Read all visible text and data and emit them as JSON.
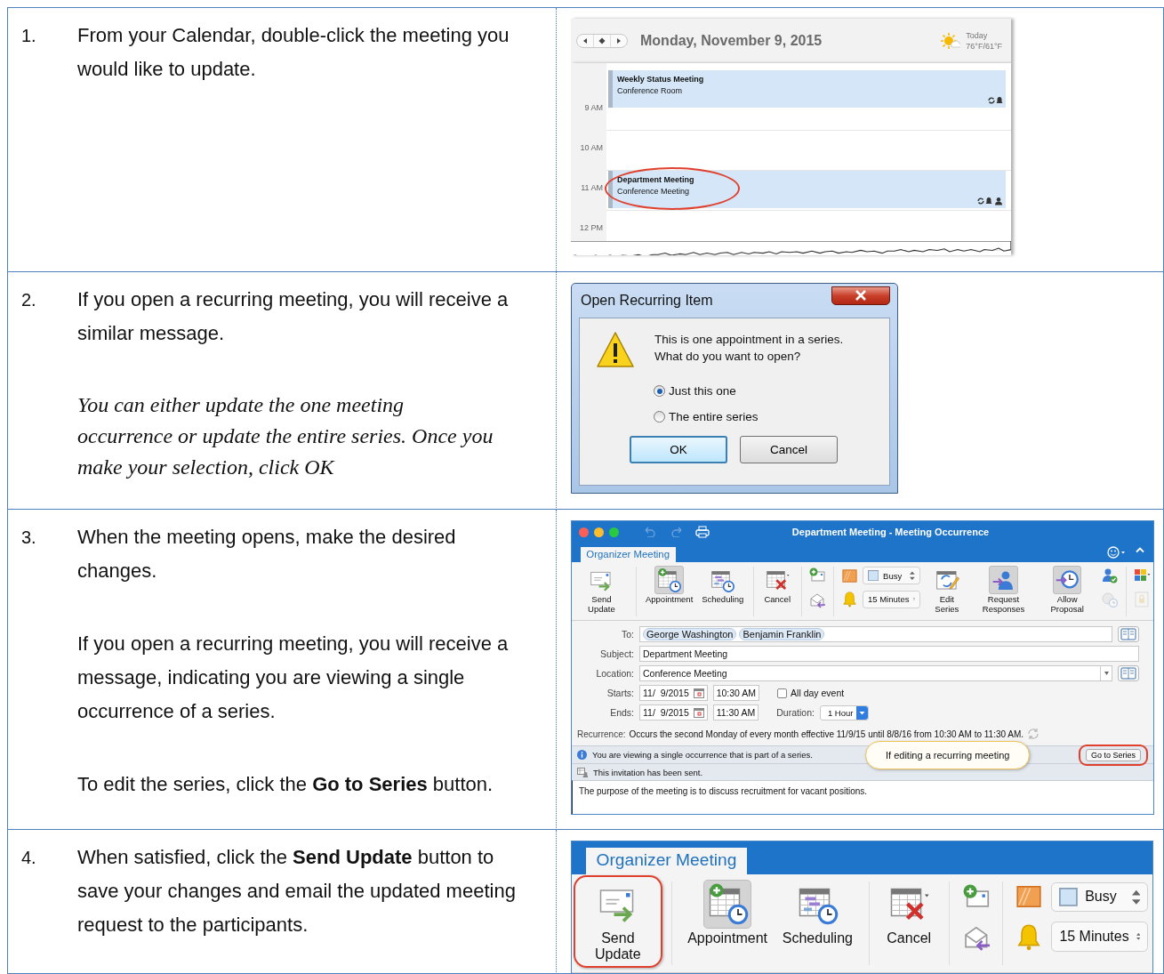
{
  "steps": [
    {
      "number": "1.",
      "paragraphs": [
        {
          "kind": "normal",
          "text": "From your Calendar, double-click the meeting you would like to update."
        }
      ],
      "screenshot": {
        "kind": "calendar",
        "date": "Monday, November 9, 2015",
        "weather": {
          "label": "Today",
          "temperature": "76°F/61°F"
        },
        "hours": [
          "9 AM",
          "10 AM",
          "11 AM",
          "12 PM"
        ],
        "events": [
          {
            "title": "Weekly Status Meeting",
            "location": "Conference Room",
            "attendees": false,
            "circled": false
          },
          {
            "title": "Department Meeting",
            "location": "Conference Meeting",
            "attendees": true,
            "circled": true
          }
        ]
      }
    },
    {
      "number": "2.",
      "paragraphs": [
        {
          "kind": "normal",
          "text": "If you open a recurring meeting, you will receive a similar message."
        },
        {
          "kind": "italic",
          "text": "You can either update the one meeting occurrence or update the entire series.  Once you make your selection, click OK"
        }
      ],
      "screenshot": {
        "kind": "dialog",
        "title": "Open Recurring Item",
        "message": [
          "This is one appointment in a series.",
          "What do you want to open?"
        ],
        "options": [
          {
            "label": "Just this one",
            "selected": true
          },
          {
            "label": "The entire series",
            "selected": false
          }
        ],
        "buttons": [
          {
            "label": "OK",
            "default": true
          },
          {
            "label": "Cancel",
            "default": false
          }
        ]
      }
    },
    {
      "number": "3.",
      "paragraphs": [
        {
          "kind": "normal",
          "text": "When the meeting opens, make the desired changes."
        },
        {
          "kind": "normal",
          "text": "If you open a recurring meeting, you will receive a message, indicating you are viewing a single occurrence of a series."
        },
        {
          "kind": "normal",
          "text": "To edit the series, click the **Go to Series** button."
        }
      ],
      "screenshot": {
        "kind": "meeting_window",
        "title": "Department Meeting - Meeting Occurrence",
        "ribbon": {
          "tab": "Organizer Meeting",
          "groups": [
            {
              "items": [
                {
                  "kind": "send",
                  "label": "Send Update",
                  "selected": false
                }
              ]
            },
            {
              "items": [
                {
                  "kind": "appointment",
                  "label": "Appointment",
                  "selected": true
                },
                {
                  "kind": "scheduling",
                  "label": "Scheduling",
                  "selected": false
                }
              ]
            },
            {
              "items": [
                {
                  "kind": "cancel",
                  "label": "Cancel",
                  "selected": false
                }
              ]
            },
            {
              "items": [
                {
                  "kind": "newmail",
                  "disabled": false
                },
                {
                  "kind": "replymail",
                  "disabled": false
                }
              ]
            },
            {
              "items": [
                {
                  "kind": "showas",
                  "value": "Busy"
                },
                {
                  "kind": "reminder",
                  "value": "15 Minutes"
                },
                {
                  "kind": "editseries",
                  "label": "Edit Series",
                  "selected": false
                },
                {
                  "kind": "request",
                  "label": "Request Responses",
                  "selected": true
                },
                {
                  "kind": "proposal",
                  "label": "Allow Proposal",
                  "selected": true
                },
                {
                  "kind": "people",
                  "disabled": false
                },
                {
                  "kind": "timezone",
                  "disabled": true
                }
              ]
            },
            {
              "items": [
                {
                  "kind": "layout",
                  "disabled": false
                },
                {
                  "kind": "lock",
                  "disabled": true
                }
              ]
            }
          ]
        },
        "form": {
          "to_label": "To:",
          "recipients": [
            "George Washington",
            "Benjamin Franklin"
          ],
          "subject_label": "Subject:",
          "subject": "Department Meeting",
          "location_label": "Location:",
          "location": "Conference Meeting",
          "starts_label": "Starts:",
          "start_date": "11/  9/2015",
          "start_time": "10:30 AM",
          "all_day": {
            "label": "All day event",
            "checked": false
          },
          "ends_label": "Ends:",
          "end_date": "11/  9/2015",
          "end_time": "11:30 AM",
          "duration_label": "Duration:",
          "duration": "1 Hour",
          "recurrence_label": "Recurrence:",
          "recurrence": "Occurs the second Monday of every month effective 11/9/15 until 8/8/16 from 10:30 AM to 11:30 AM."
        },
        "info_bar": {
          "message": "You are viewing a single occurrence that is part of a series.",
          "callout": "If editing a recurring meeting",
          "button": "Go to Series",
          "circled": true
        },
        "status": "This invitation has been sent.",
        "body": "The purpose of the meeting is to discuss recruitment for vacant positions."
      }
    },
    {
      "number": "4.",
      "paragraphs": [
        {
          "kind": "normal",
          "text": "When satisfied, click the **Send Update** button to save your changes and email the updated meeting request to the participants."
        }
      ],
      "screenshot": {
        "kind": "ribbon",
        "ribbon": {
          "tab": "Organizer Meeting",
          "groups": [
            {
              "items": [
                {
                  "kind": "send",
                  "label": "Send Update",
                  "selected": false,
                  "circled": true
                }
              ]
            },
            {
              "items": [
                {
                  "kind": "appointment",
                  "label": "Appointment",
                  "selected": true,
                  "circled": false
                },
                {
                  "kind": "scheduling",
                  "label": "Scheduling",
                  "selected": false,
                  "circled": false
                }
              ]
            },
            {
              "items": [
                {
                  "kind": "cancel",
                  "label": "Cancel",
                  "selected": false,
                  "circled": false
                }
              ]
            },
            {
              "items": [
                {
                  "kind": "newmail",
                  "disabled": false
                },
                {
                  "kind": "replymail",
                  "disabled": false
                }
              ]
            },
            {
              "items": [
                {
                  "kind": "showas",
                  "value": "Busy"
                },
                {
                  "kind": "reminder",
                  "value": "15 Minutes"
                }
              ]
            }
          ]
        }
      }
    }
  ]
}
